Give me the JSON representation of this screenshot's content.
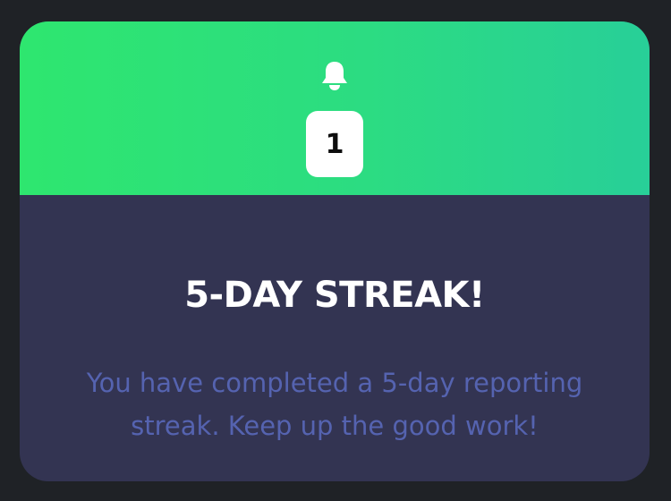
{
  "notification": {
    "icon": "bell-icon",
    "count": "1",
    "title": "5-DAY STREAK!",
    "message": "You have completed a 5-day reporting streak. Keep up the good work!"
  },
  "colors": {
    "background": "#1f2226",
    "card": "#333452",
    "header_gradient_start": "#2ee66f",
    "header_gradient_end": "#28cf98",
    "badge": "#ffffff",
    "title": "#ffffff",
    "message": "#5563b0"
  }
}
